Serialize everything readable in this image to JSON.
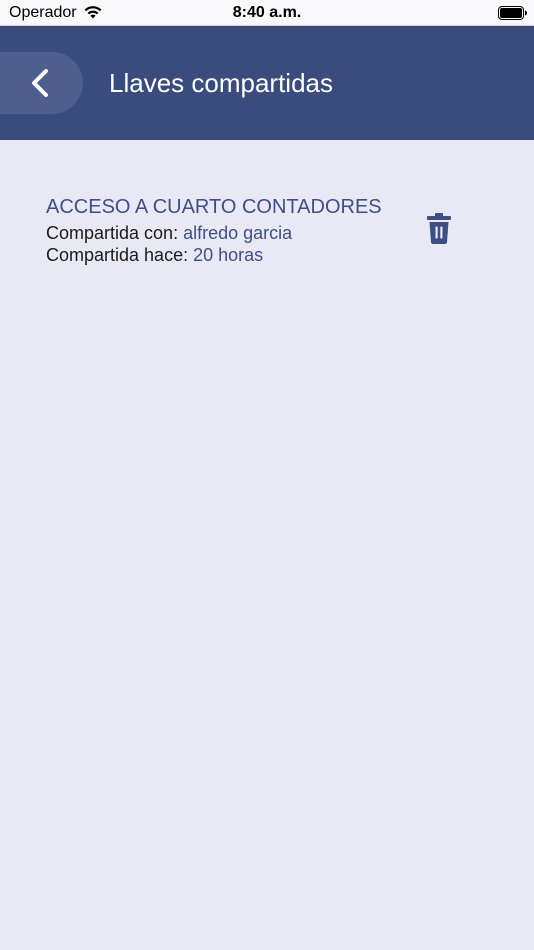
{
  "status_bar": {
    "carrier": "Operador",
    "time": "8:40 a.m."
  },
  "header": {
    "title": "Llaves compartidas",
    "back_icon": "chevron-left-icon"
  },
  "shared_keys": [
    {
      "name": "ACCESO A CUARTO CONTADORES",
      "shared_with_label": "Compartida con:",
      "shared_with_value": "alfredo garcia",
      "shared_ago_label": "Compartida hace:",
      "shared_ago_value": "20 horas",
      "delete_icon": "trash-icon"
    }
  ],
  "colors": {
    "header_bg": "#3a4c7e",
    "accent_text": "#3d4f84",
    "page_bg": "#e8e9f5"
  }
}
